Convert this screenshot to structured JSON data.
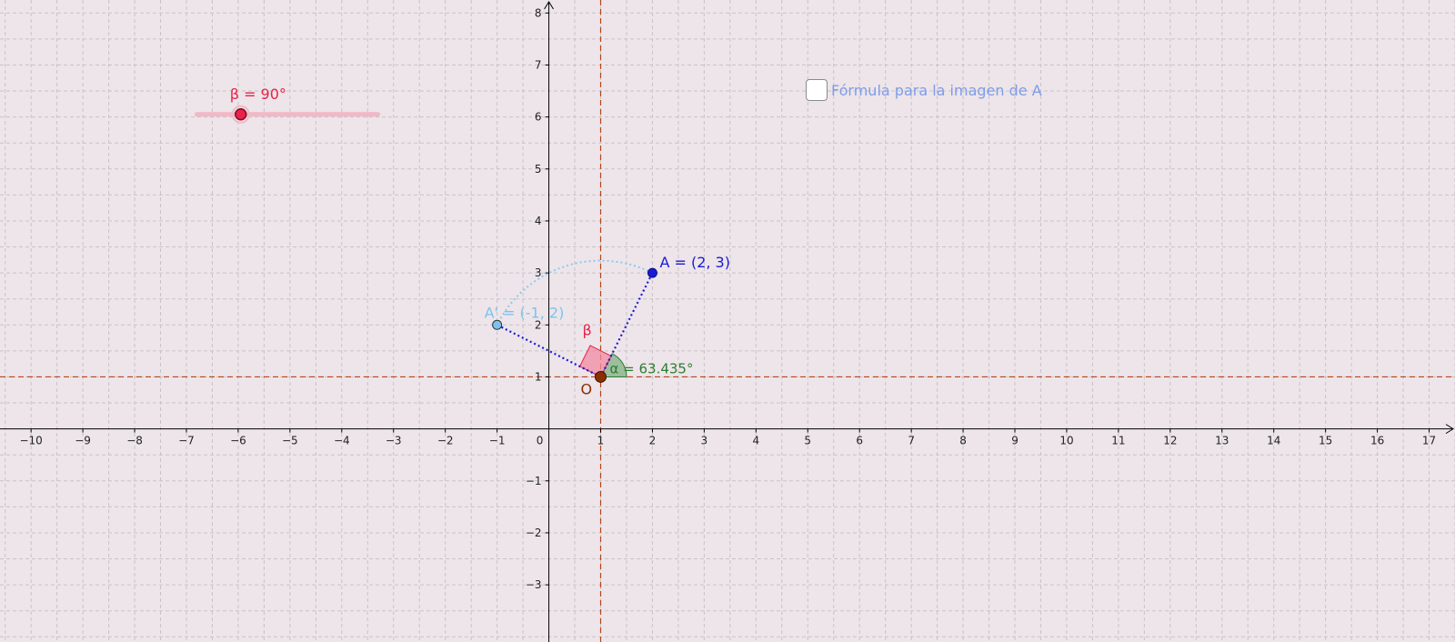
{
  "app": "GeoGebra",
  "graphics_view": {
    "x_range": [
      -10.6,
      17.5
    ],
    "y_range": [
      -4.1,
      8.25
    ],
    "grid": true,
    "x_tick_labels": [
      "−10",
      "−9",
      "−8",
      "−7",
      "−6",
      "−5",
      "−4",
      "−3",
      "−2",
      "−1",
      "0",
      "1",
      "2",
      "3",
      "4",
      "5",
      "6",
      "7",
      "8",
      "9",
      "10",
      "11",
      "12",
      "13",
      "14",
      "15",
      "16",
      "17"
    ],
    "y_tick_labels": [
      "−3",
      "−2",
      "−1",
      "1",
      "2",
      "3",
      "4",
      "5",
      "6",
      "7",
      "8"
    ]
  },
  "slider": {
    "label": "β = 90°",
    "value_deg": 90,
    "min_deg": 0,
    "max_deg": 360,
    "track_x": [
      -6.8,
      -3.3
    ],
    "track_y": 6.05,
    "knob_x": -5.95
  },
  "checkbox": {
    "label": "Fórmula para la imagen de A",
    "checked": false
  },
  "points": {
    "A": {
      "x": 2,
      "y": 3,
      "label": "A = (2, 3)",
      "color": "#1a1ad6"
    },
    "A_prime": {
      "x": -1,
      "y": 2,
      "label": "A' = (-1, 2)",
      "color": "#7cc2ee"
    },
    "O": {
      "x": 1,
      "y": 1,
      "label": "O",
      "color": "#8b2f00"
    }
  },
  "angles": {
    "alpha": {
      "label": "α = 63.435°",
      "degrees": 63.435,
      "color": "#2e7d32"
    },
    "beta": {
      "label": "β",
      "degrees": 90,
      "color": "#e8224a"
    }
  },
  "colors": {
    "axis": "#000000",
    "grid": "#c8c3c6",
    "guide_lines": "#b5441c",
    "segments": "#1a1ad6",
    "arc": "#8ec8ef",
    "slider": "#e8224a"
  }
}
